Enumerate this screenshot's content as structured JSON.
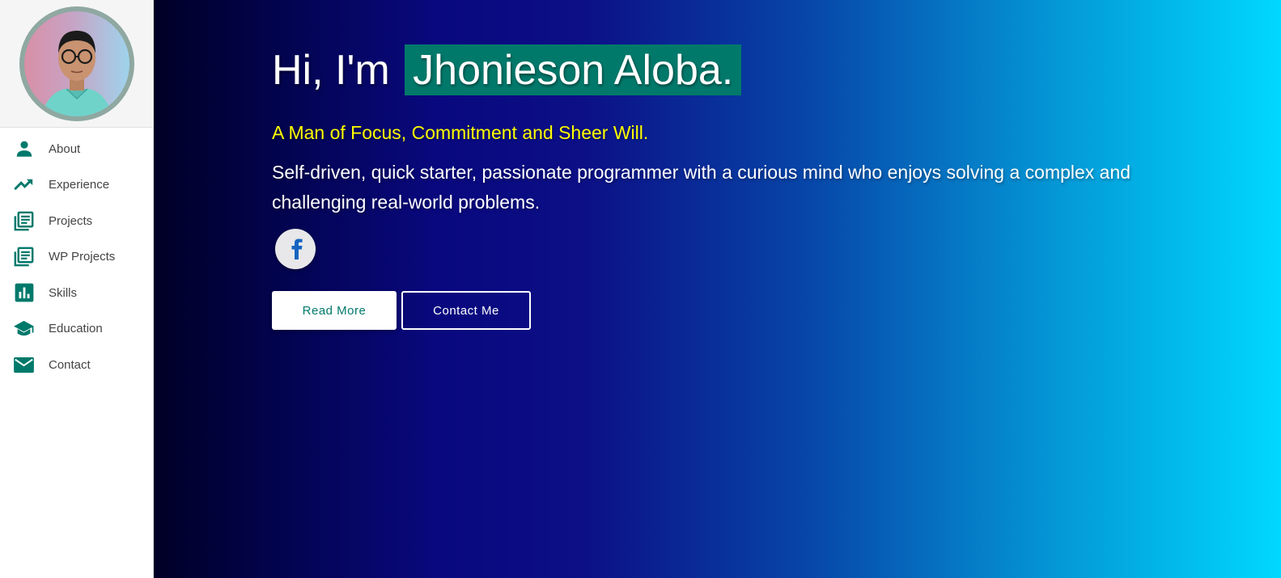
{
  "profile": {
    "greeting": "Hi, I'm",
    "name": "Jhonieson Aloba.",
    "tagline": "A Man of Focus, Commitment and Sheer Will.",
    "bio": "Self-driven, quick starter, passionate programmer with a curious mind who enjoys solving a complex and challenging real-world problems."
  },
  "sidebar": {
    "items": [
      {
        "label": "About",
        "icon": "person-icon"
      },
      {
        "label": "Experience",
        "icon": "trending-up-icon"
      },
      {
        "label": "Projects",
        "icon": "library-books-icon"
      },
      {
        "label": "WP Projects",
        "icon": "library-books-icon"
      },
      {
        "label": "Skills",
        "icon": "bar-chart-icon"
      },
      {
        "label": "Education",
        "icon": "school-icon"
      },
      {
        "label": "Contact",
        "icon": "mail-icon"
      }
    ]
  },
  "social": {
    "facebook_icon": "facebook-icon"
  },
  "actions": {
    "read_more": "Read More",
    "contact_me": "Contact Me"
  },
  "colors": {
    "accent": "#00796b",
    "tagline": "#ffff00",
    "gradient_start": "#000026",
    "gradient_mid": "#09087e",
    "gradient_end": "#00d8ff"
  }
}
